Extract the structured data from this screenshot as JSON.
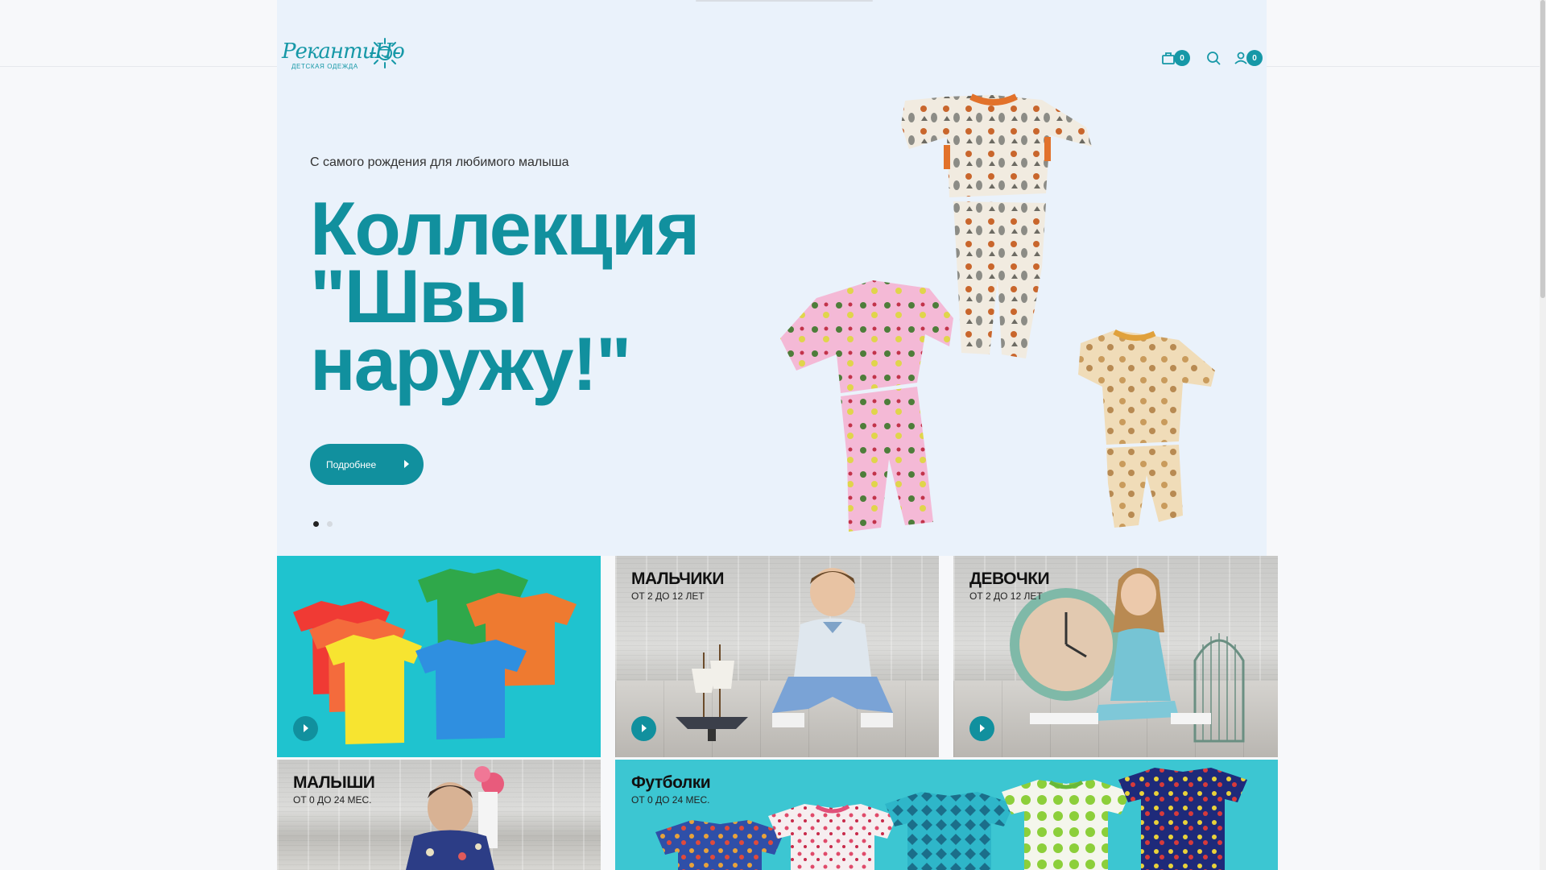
{
  "header": {
    "logo_text": "РекантиНо",
    "logo_sub": "ДЕТСКАЯ ОДЕЖДА",
    "cart_count": "0",
    "user_count": "0"
  },
  "hero": {
    "subtitle": "С самого рождения для любимого малыша",
    "title_line1": "Коллекция",
    "title_line2": "\"Швы",
    "title_line3": "наружу!\"",
    "button_label": "Подробнее",
    "slides": 2,
    "active_slide": 1
  },
  "tiles": [
    {
      "title": "",
      "subtitle": ""
    },
    {
      "title": "МАЛЬЧИКИ",
      "subtitle": "ОТ 2 ДО 12 ЛЕТ"
    },
    {
      "title": "ДЕВОЧКИ",
      "subtitle": "ОТ 2 ДО 12 ЛЕТ"
    },
    {
      "title": "МАЛЫШИ",
      "subtitle": "ОТ 0 ДО 24 МЕС."
    },
    {
      "title": "Футболки",
      "subtitle": "ОТ 0 ДО 24 МЕС."
    }
  ],
  "colors": {
    "accent": "#11909e",
    "hero_bg": "#eaf2fb",
    "tshirt_tile_bg": "#1fc3cf",
    "tshirt_tile2_bg": "#3cc6d2"
  }
}
